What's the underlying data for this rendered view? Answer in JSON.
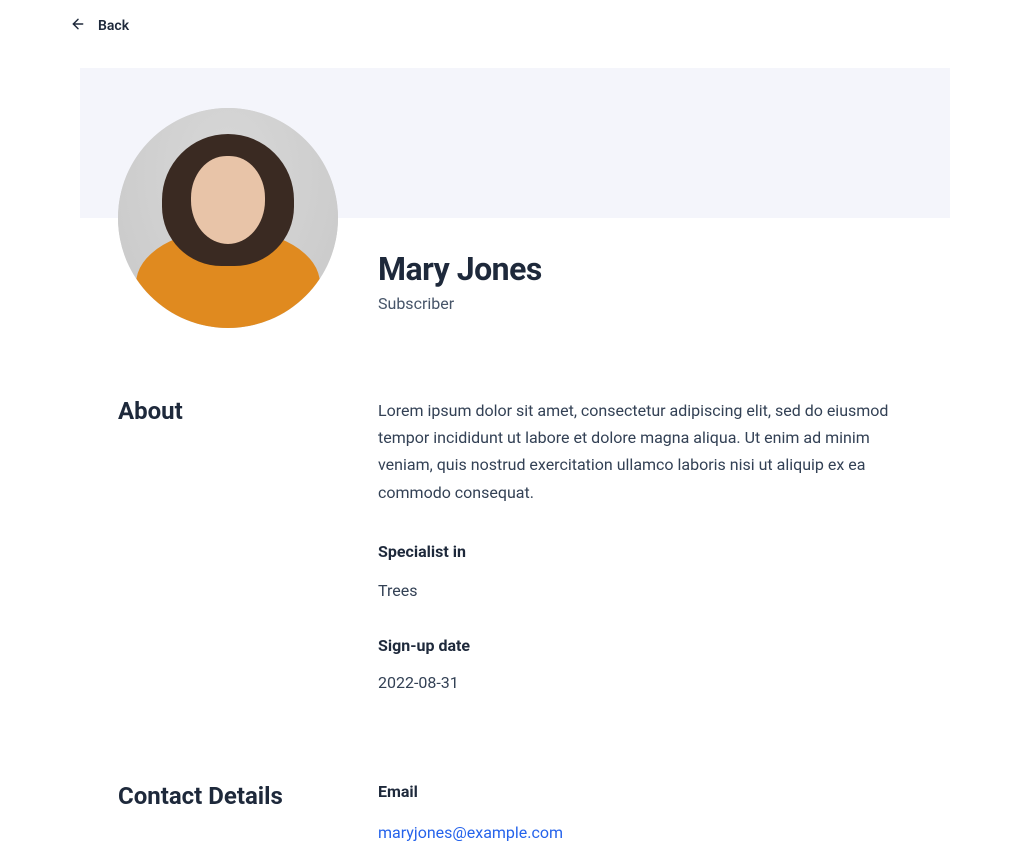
{
  "nav": {
    "back_label": "Back"
  },
  "profile": {
    "name": "Mary Jones",
    "role": "Subscriber"
  },
  "about": {
    "section_title": "About",
    "description": "Lorem ipsum dolor sit amet, consectetur adipiscing elit, sed do eiusmod tempor incididunt ut labore et dolore magna aliqua. Ut enim ad minim veniam, quis nostrud exercitation ullamco laboris nisi ut aliquip ex ea commodo consequat.",
    "specialist_label": "Specialist in",
    "specialist_value": "Trees",
    "signup_label": "Sign-up date",
    "signup_value": "2022-08-31"
  },
  "contact": {
    "section_title": "Contact Details",
    "email_label": "Email",
    "email_value": "maryjones@example.com"
  }
}
